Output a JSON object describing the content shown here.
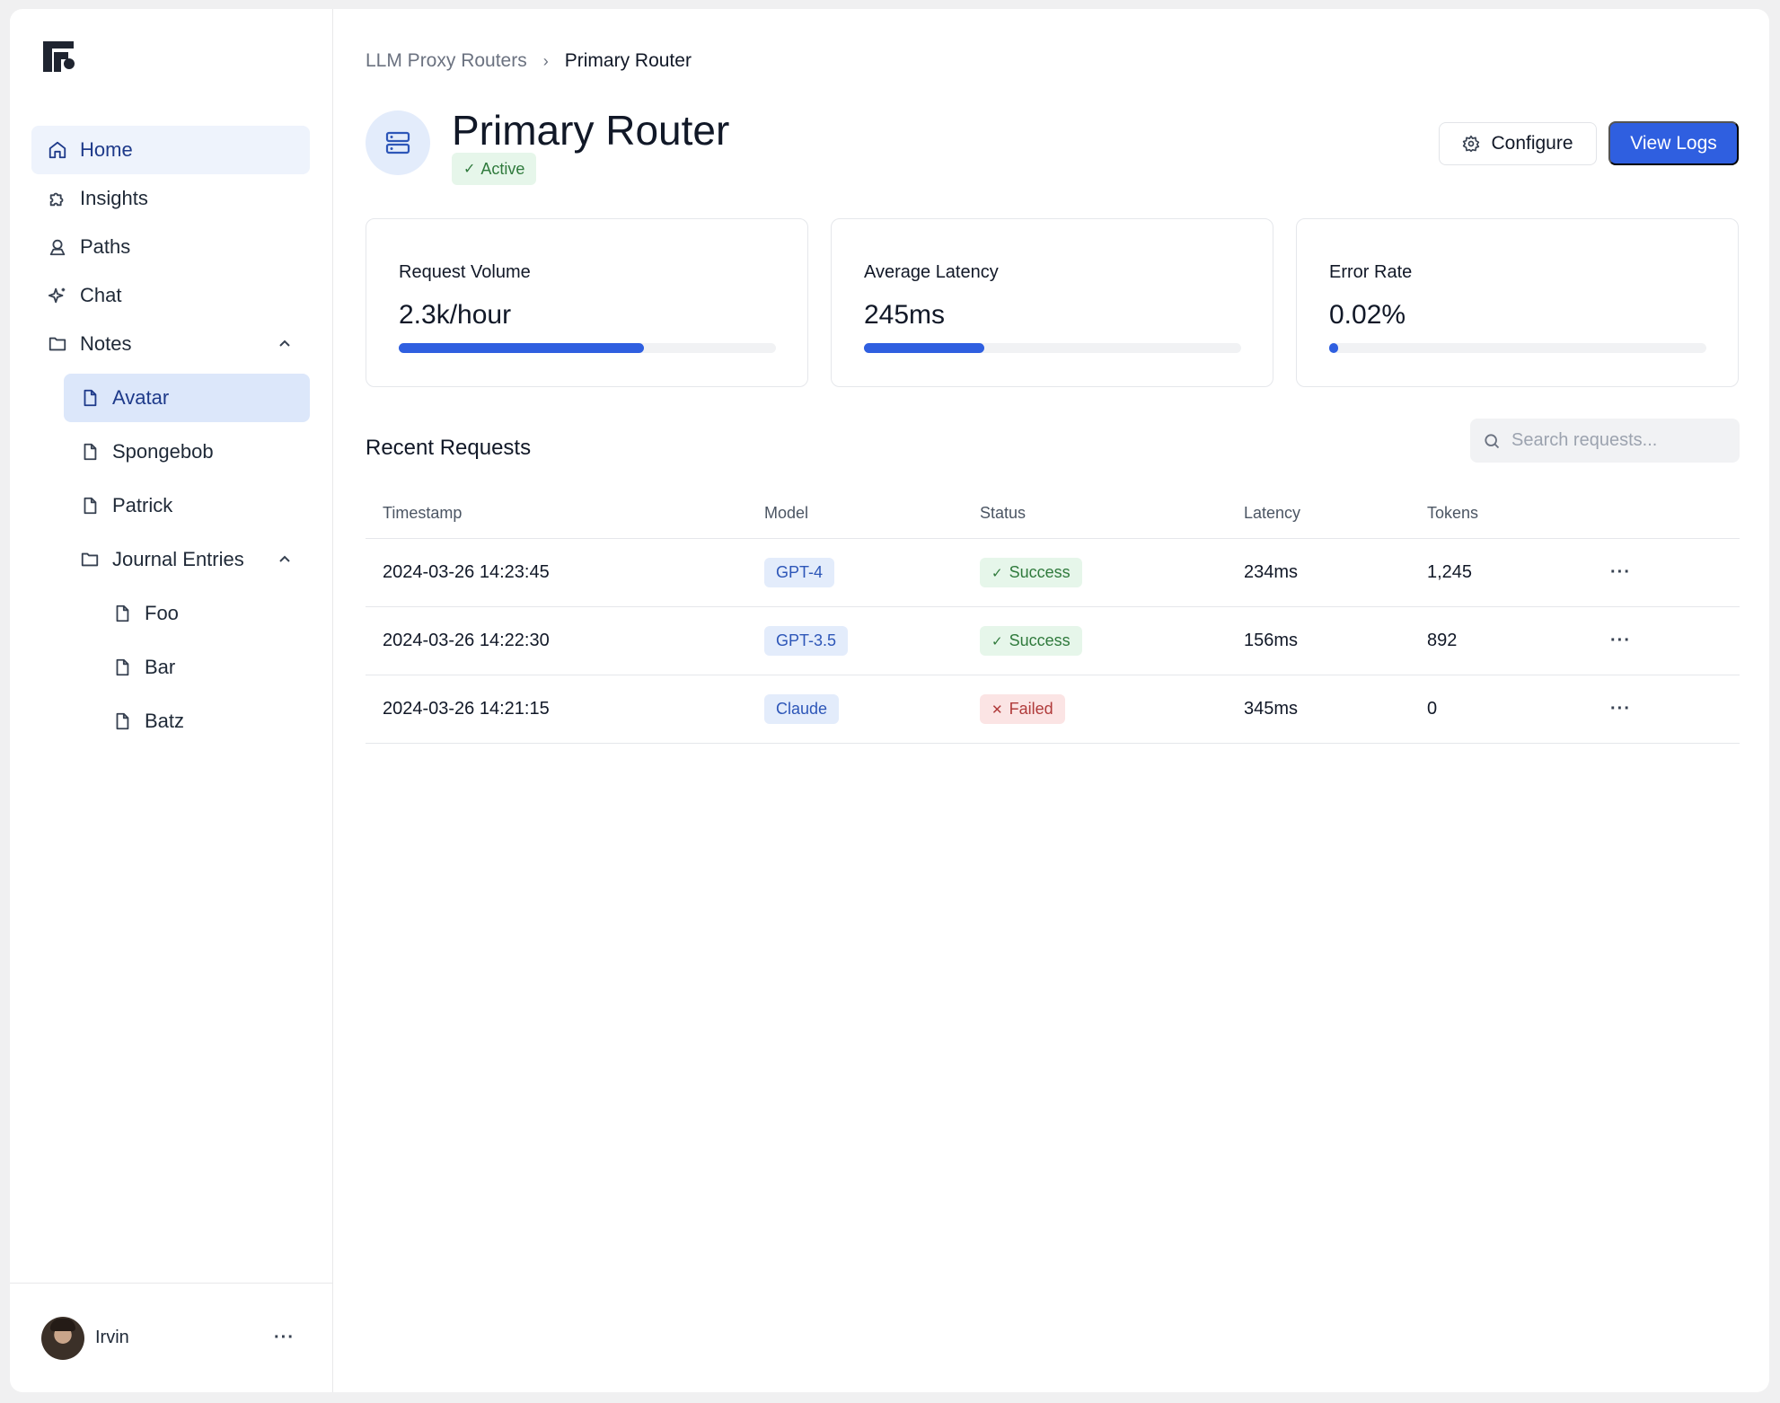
{
  "sidebar": {
    "nav": [
      {
        "label": "Home",
        "icon": "home-icon"
      },
      {
        "label": "Insights",
        "icon": "puzzle-icon"
      },
      {
        "label": "Paths",
        "icon": "user-pin-icon"
      },
      {
        "label": "Chat",
        "icon": "sparkle-icon"
      },
      {
        "label": "Notes",
        "icon": "folder-icon"
      }
    ],
    "notes": [
      {
        "label": "Avatar"
      },
      {
        "label": "Spongebob"
      },
      {
        "label": "Patrick"
      },
      {
        "label": "Journal Entries"
      }
    ],
    "journal": [
      {
        "label": "Foo"
      },
      {
        "label": "Bar"
      },
      {
        "label": "Batz"
      }
    ],
    "user": {
      "name": "Irvin",
      "menu": "···"
    }
  },
  "breadcrumb": {
    "parent": "LLM Proxy Routers",
    "separator": "›",
    "current": "Primary Router"
  },
  "header": {
    "title": "Primary Router",
    "status": "Active",
    "configure_label": "Configure",
    "logs_label": "View Logs"
  },
  "stats": [
    {
      "label": "Request Volume",
      "value": "2.3k/hour",
      "progress": 0.65
    },
    {
      "label": "Average Latency",
      "value": "245ms",
      "progress": 0.32
    },
    {
      "label": "Error Rate",
      "value": "0.02%",
      "progress": 0.02
    }
  ],
  "requests": {
    "title": "Recent Requests",
    "search_placeholder": "Search requests...",
    "columns": [
      "Timestamp",
      "Model",
      "Status",
      "Latency",
      "Tokens"
    ],
    "rows": [
      {
        "timestamp": "2024-03-26 14:23:45",
        "model": "GPT-4",
        "status": "Success",
        "latency": "234ms",
        "tokens": "1,245",
        "menu": "···"
      },
      {
        "timestamp": "2024-03-26 14:22:30",
        "model": "GPT-3.5",
        "status": "Success",
        "latency": "156ms",
        "tokens": "892",
        "menu": "···"
      },
      {
        "timestamp": "2024-03-26 14:21:15",
        "model": "Claude",
        "status": "Failed",
        "latency": "345ms",
        "tokens": "0",
        "menu": "···"
      }
    ]
  },
  "colors": {
    "accent": "#2f5fe0",
    "success": "#2f7a3c",
    "failed": "#b03a3a"
  }
}
